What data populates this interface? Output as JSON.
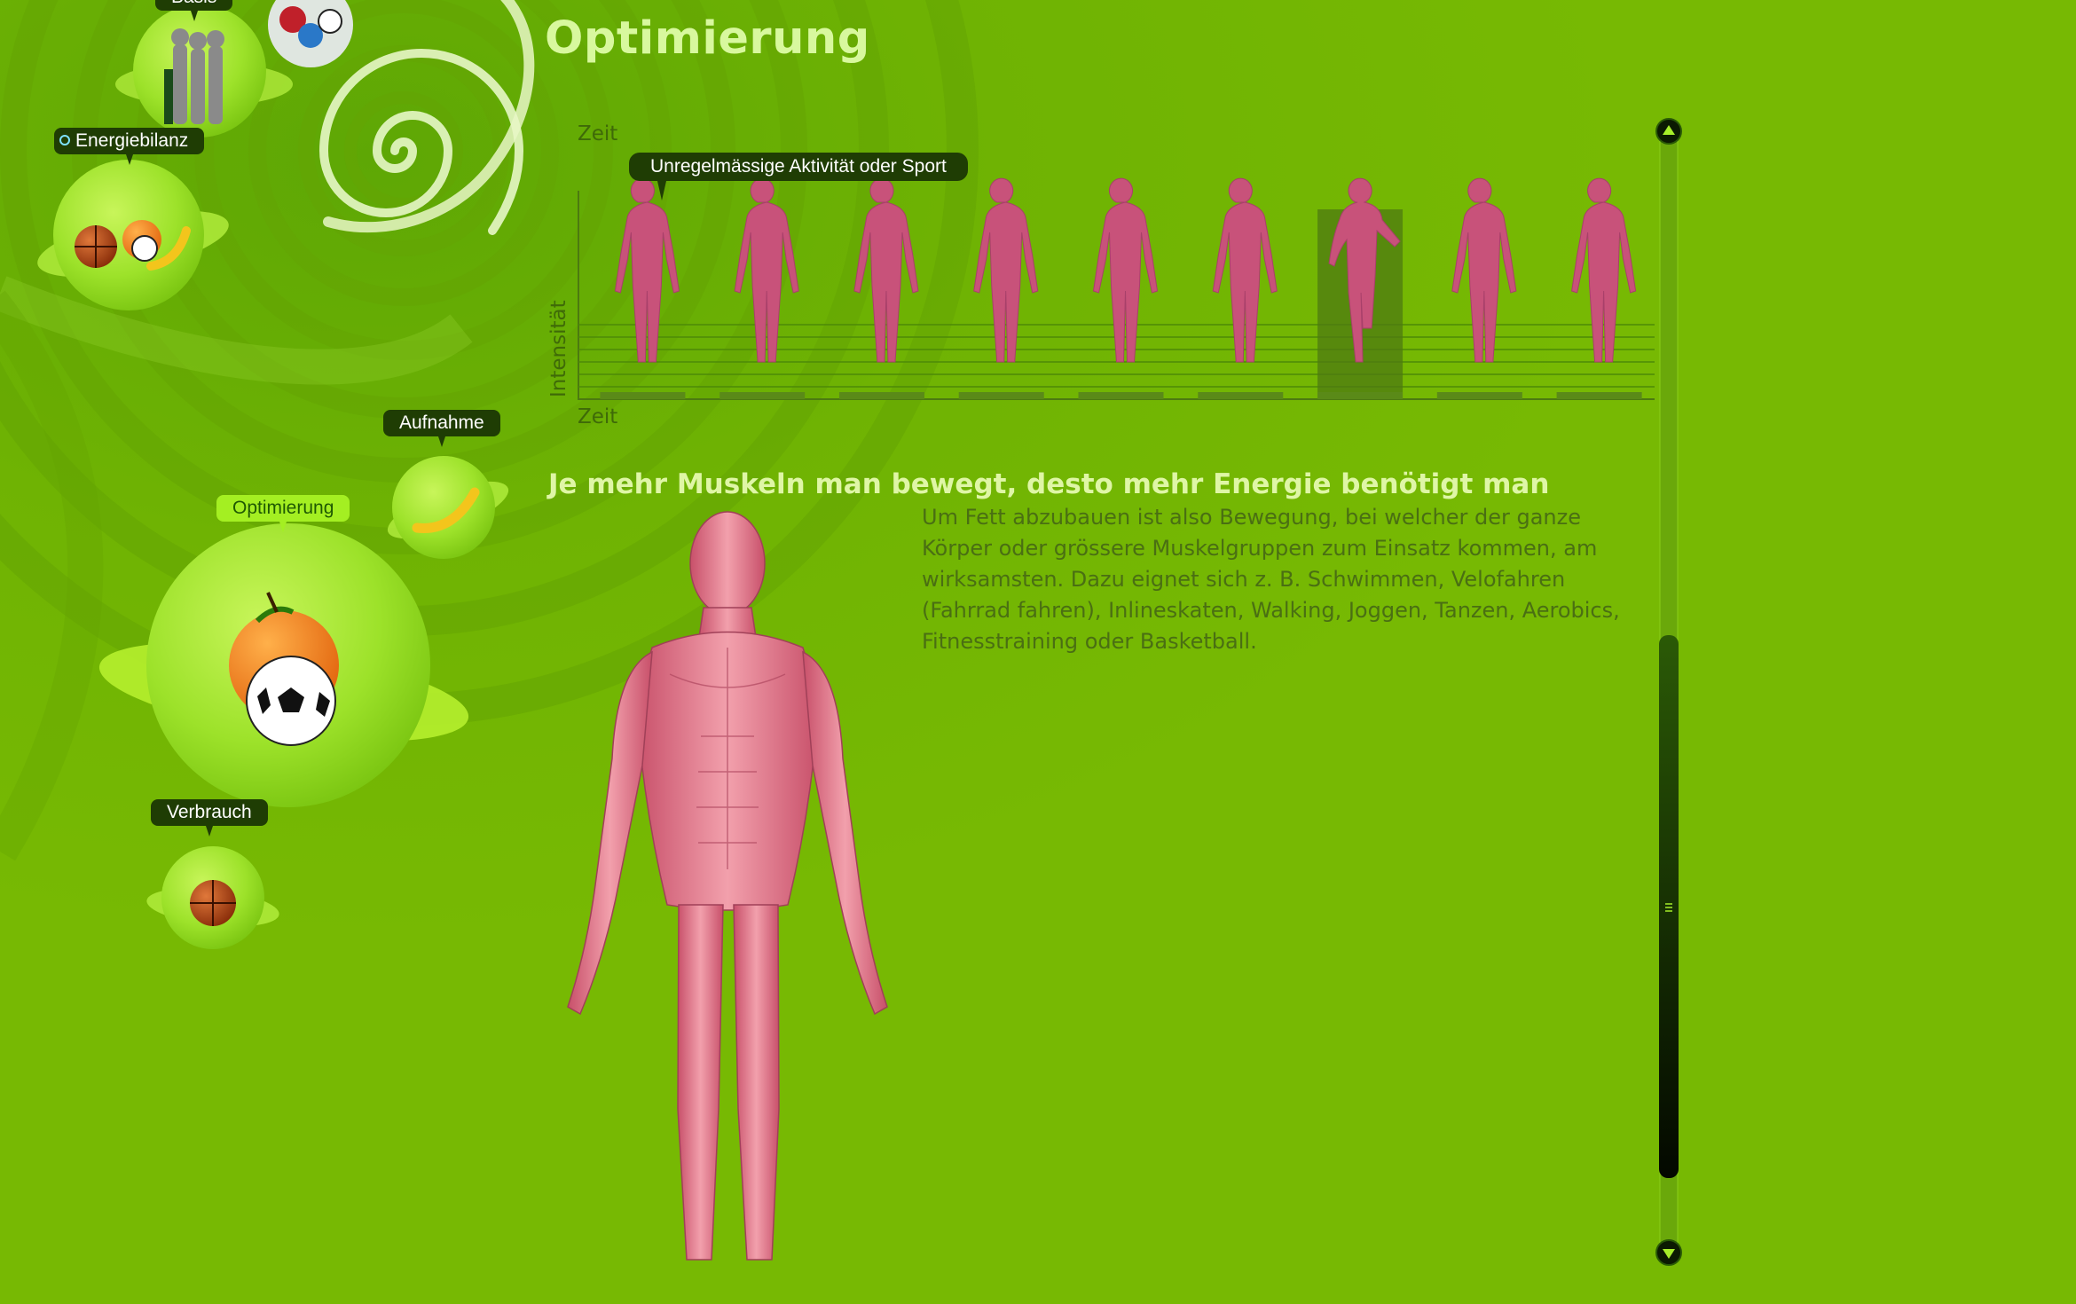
{
  "page": {
    "title": "Optimierung"
  },
  "nav": {
    "items": [
      {
        "label": "Basis",
        "icon": "people-globe-icon"
      },
      {
        "label": "Energiebilanz",
        "icon": "basketball-orange-banana-icon"
      },
      {
        "label": "Aufnahme",
        "icon": "banana-icon"
      },
      {
        "label": "Optimierung",
        "icon": "orange-soccer-ball-icon",
        "active": true
      },
      {
        "label": "Verbrauch",
        "icon": "basketball-icon"
      }
    ]
  },
  "chart": {
    "y_axis_label": "Intensität",
    "top_label": "Zeit",
    "x_axis_label": "Zeit",
    "bubble": "Unregelmässige Aktivität oder Sport",
    "figures": 9,
    "highlighted_index": 7
  },
  "content": {
    "heading": "Je mehr Muskeln man bewegt, desto mehr Energie benötigt man",
    "body": "Um Fett abzubauen ist also Bewegung, bei welcher der ganze Körper oder grössere Muskelgruppen zum Einsatz kommen, am wirksamsten. Dazu eignet sich z. B. Schwimmen, Velofahren (Fahrrad fahren), Inlineskaten, Walking, Joggen, Tanzen, Aerobics, Fitnesstraining oder Basketball."
  },
  "scrollbar": {
    "position": 0.48
  },
  "colors": {
    "background": "#76b804",
    "title": "#d8f89e",
    "label_bg": "#1f3d04",
    "figure": "#c8527a"
  }
}
